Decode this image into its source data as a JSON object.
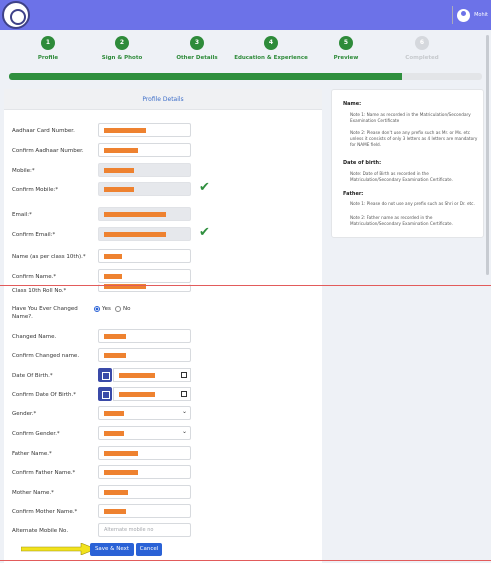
{
  "header": {
    "user_name": "Mohit"
  },
  "stepper": {
    "steps": [
      {
        "number": "1",
        "label": "Profile"
      },
      {
        "number": "2",
        "label": "Sign & Photo"
      },
      {
        "number": "3",
        "label": "Other Details"
      },
      {
        "number": "4",
        "label": "Education & Experience"
      },
      {
        "number": "5",
        "label": "Preview"
      },
      {
        "number": "6",
        "label": "Completed"
      }
    ],
    "progress_fraction": 0.83
  },
  "form": {
    "title": "Profile Details",
    "fields": {
      "aadhaar": "Aadhaar Card Number.",
      "confirm_aadhaar": "Confirm Aadhaar Number.",
      "mobile": "Mobile:*",
      "confirm_mobile": "Confirm Mobile:*",
      "email": "Email:*",
      "confirm_email": "Confirm Email:*",
      "name": "Name (as per class 10th).*",
      "confirm_name": "Confirm Name.*",
      "roll_no": "Class 10th Roll No.*",
      "changed_name_q": "Have You Ever Changed Name?.",
      "changed_name": "Changed Name.",
      "confirm_changed_name": "Confirm Changed name.",
      "dob": "Date Of Birth.*",
      "confirm_dob": "Confirm Date Of Birth.*",
      "gender": "Gender.*",
      "confirm_gender": "Confirm Gender.*",
      "father_name": "Father Name.*",
      "confirm_father_name": "Confirm Father Name.*",
      "mother_name": "Mother Name.*",
      "confirm_mother_name": "Confirm Mother Name.*",
      "alt_mobile": "Alternate Mobile No."
    },
    "radio": {
      "yes": "Yes",
      "no": "No",
      "selected": "Yes"
    },
    "alt_mobile_placeholder": "Alternate mobile no",
    "save_label": "Save & Next",
    "cancel_label": "Cancel"
  },
  "notes": {
    "name_heading": "Name:",
    "name_note1": "Note 1: Name as recorded in the Matriculation/Secondary Examination Certificate",
    "name_note2": "Note 2: Please don't use any prefix such as Mr. or Ms. etc unless it consists of only 3 letters as 4 letters are mandatory for NAME field.",
    "dob_heading": "Date of birth:",
    "dob_note": "Note: Date of Birth as recorded in the Matriculation/Secondary Examination Certificate.",
    "father_heading": "Father:",
    "father_note1": "Note 1: Please do not use any prefix such as Shri or Dr. etc.",
    "father_note2": "Note 2: Father name as recorded in the Matriculation/Secondary Examination Certificate."
  },
  "colors": {
    "topbar": "#6c72e8",
    "step_done": "#2e8b3a",
    "step_pending": "#d5d8dd",
    "redaction": "#ee8230",
    "primary_button": "#2a62d6",
    "annotation_arrow": "#f2e21c"
  }
}
